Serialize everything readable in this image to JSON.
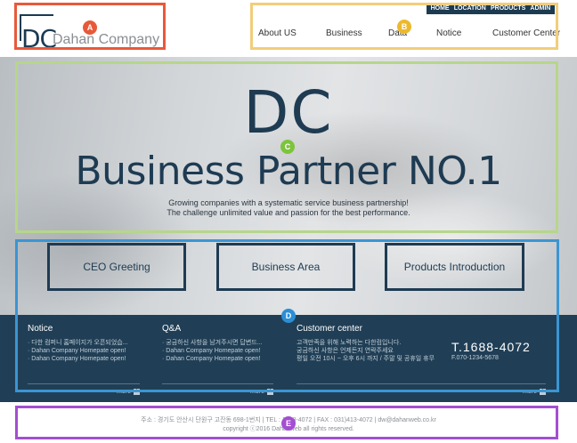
{
  "header": {
    "logo_mark": "DC",
    "logo_text": "Dahan Company",
    "utility_links": [
      "HOME",
      "LOCATION",
      "PRODUCTS",
      "ADMIN"
    ],
    "nav": [
      "About US",
      "Business",
      "Data",
      "Notice",
      "Customer Center"
    ]
  },
  "hero": {
    "mark": "DC",
    "title": "Business Partner NO.1",
    "subtitle_line1": "Growing companies with a systematic service business partnership!",
    "subtitle_line2": "The challenge unlimited value and passion for the best performance.",
    "quick_links": [
      "CEO Greeting",
      "Business Area",
      "Products Introduction"
    ]
  },
  "info": {
    "notice": {
      "title": "Notice",
      "items": [
        "· 다한 컴퍼니 홈페이지가 오픈되었습...",
        "· Dahan Company Homepate open!",
        "· Dahan Company Homepate open!"
      ],
      "more": "more"
    },
    "qna": {
      "title": "Q&A",
      "items": [
        "· 궁금하신 사항을 남겨주시면 답변드...",
        "· Dahan Company Homepate open!",
        "· Dahan Company Homepate open!"
      ],
      "more": "more"
    },
    "customer": {
      "title": "Customer center",
      "lines": [
        "고객만족을 위해 노력하는 다한컴입니다.",
        "궁금하신 사항은 언제든지 연락주세요",
        "평일 오전 10시 ~ 오후 6시 까지 / 주말 및 공휴일 휴무"
      ],
      "phone": "T.1688-4072",
      "fax": "F.070-1234-5678",
      "more": "more"
    }
  },
  "footer": {
    "address": "주소 : 경기도 안산시 단원구 고잔동 698-1번지 | TEL : 1688-4072 | FAX : 031)413-4072 | dw@dahanweb.co.kr",
    "copyright": "copyright ⓒ2016 Dahanweb all rights reserved."
  },
  "annotations": [
    "A",
    "B",
    "C",
    "D",
    "E"
  ],
  "colors": {
    "brand_navy": "#1e3b52",
    "band_bg": "#203f56",
    "box_a": "#e8593a",
    "box_b": "#f2cd7a",
    "box_c": "#b7d68a",
    "box_d": "#3b95d3",
    "box_e": "#a34fd1"
  }
}
